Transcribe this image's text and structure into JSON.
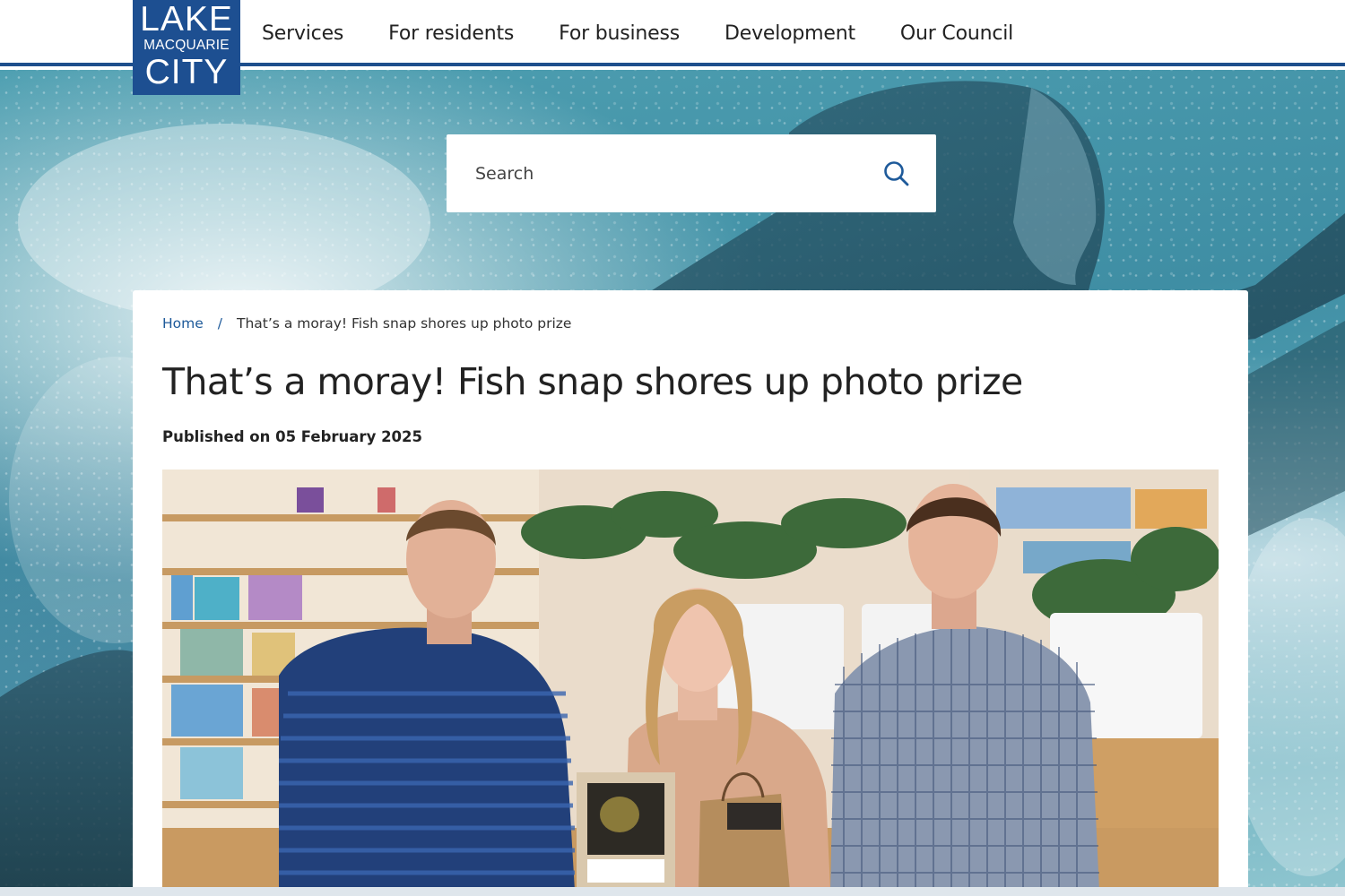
{
  "logo": {
    "line1": "LAKE",
    "line2": "MACQUARIE",
    "line3": "CITY",
    "color": "#1d4f91"
  },
  "nav": {
    "items": [
      {
        "label": "Services"
      },
      {
        "label": "For residents"
      },
      {
        "label": "For business"
      },
      {
        "label": "Development"
      },
      {
        "label": "Our Council"
      }
    ]
  },
  "search": {
    "placeholder": "Search",
    "icon": "search-icon"
  },
  "breadcrumb": {
    "home": "Home",
    "separator": "/",
    "current": "That’s a moray! Fish snap shores up photo prize"
  },
  "article": {
    "title": "That’s a moray! Fish snap shores up photo prize",
    "published": "Published on 05 February 2025"
  },
  "colors": {
    "accent": "#1e4f8c",
    "link": "#1e5a9a",
    "text": "#222222"
  }
}
